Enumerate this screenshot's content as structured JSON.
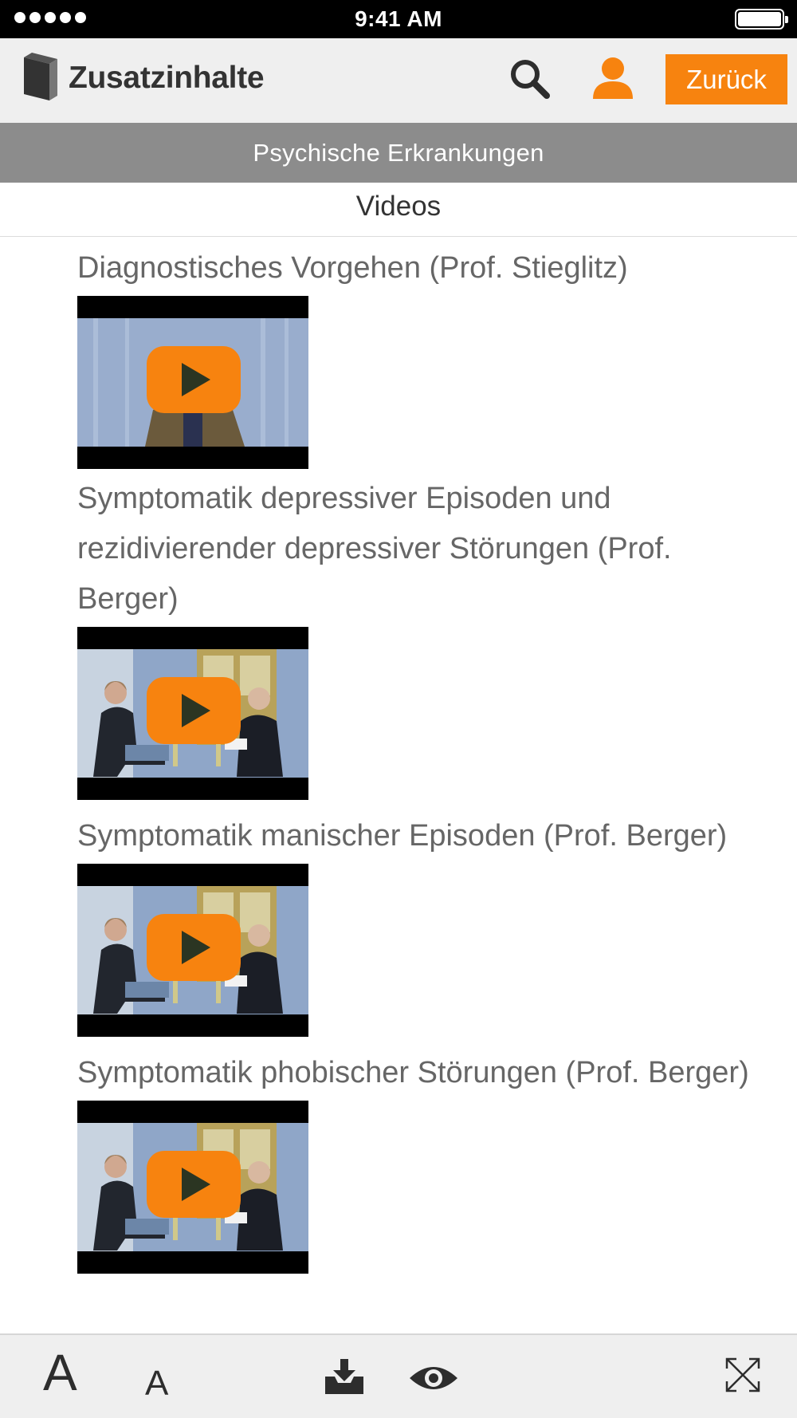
{
  "status_bar": {
    "time": "9:41 AM",
    "signal_dots": 5
  },
  "header": {
    "title": "Zusatzinhalte",
    "back_label": "Zurück",
    "icons": {
      "logo": "book-icon",
      "search": "search-icon",
      "user": "user-icon"
    },
    "accent_color": "#f7830f"
  },
  "category": "Psychische Erkrankungen",
  "section_title": "Videos",
  "videos": [
    {
      "title": "Diagnostisches Vorgehen (Prof. Stieglitz)"
    },
    {
      "title": "Symptomatik depressiver Episoden und rezidivierender depressiver Störungen (Prof. Berger)"
    },
    {
      "title": "Symptomatik manischer Episoden (Prof. Berger)"
    },
    {
      "title": "Symptomatik phobischer Störungen (Prof. Berger)"
    }
  ],
  "toolbar": {
    "font_increase_label": "A",
    "font_decrease_label": "A",
    "icons": [
      "download-tray-icon",
      "eye-icon",
      "fullscreen-icon"
    ]
  }
}
